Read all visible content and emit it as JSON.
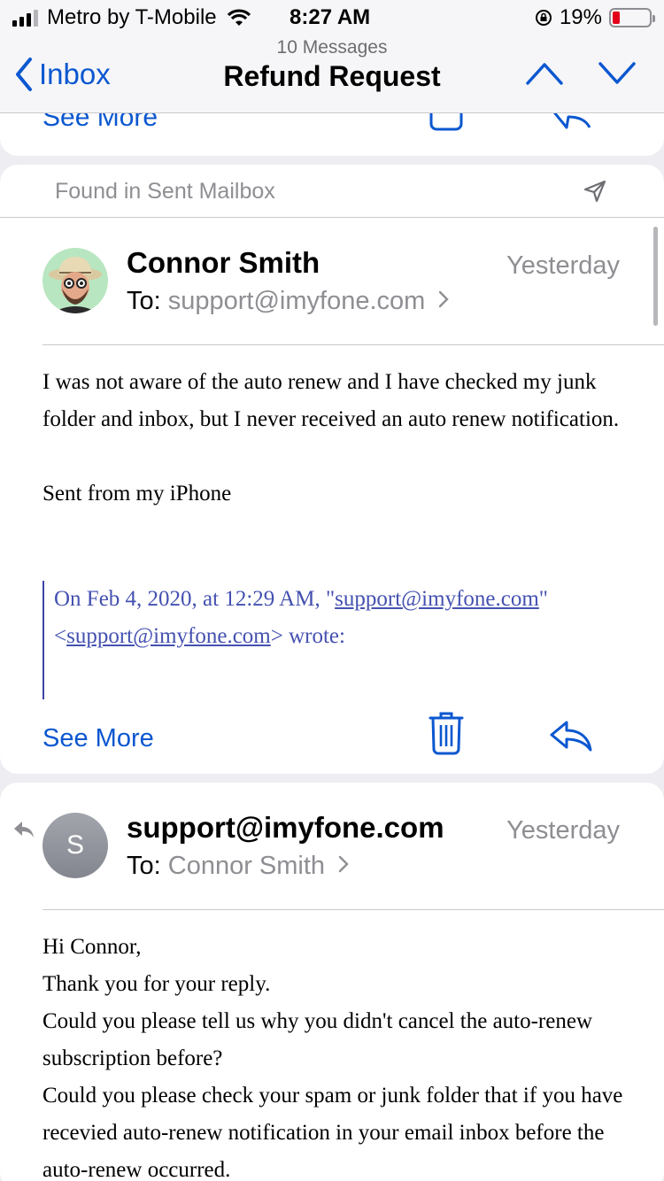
{
  "status_bar": {
    "carrier": "Metro by T-Mobile",
    "time": "8:27 AM",
    "battery_percent": "19%",
    "battery_level": 0.19
  },
  "nav": {
    "back_label": "Inbox",
    "message_count": "10 Messages",
    "title": "Refund Request"
  },
  "prev_card": {
    "see_more": "See More"
  },
  "card2": {
    "found_label": "Found in Sent Mailbox",
    "sender": "Connor Smith",
    "date": "Yesterday",
    "to_label": "To:",
    "to_address": "support@imyfone.com",
    "body": [
      "I was not aware of the auto renew and I have checked my junk folder and inbox, but I never received an auto renew notification.",
      "Sent from my iPhone"
    ],
    "quote_prefix": "On Feb 4, 2020, at 12:29 AM, \"",
    "quote_link1": "support@imyfone.com",
    "quote_mid": "\" <",
    "quote_link2": "support@imyfone.com",
    "quote_suffix": "> wrote:",
    "see_more": "See More"
  },
  "card3": {
    "avatar_letter": "S",
    "sender": "support@imyfone.com",
    "date": "Yesterday",
    "to_label": "To:",
    "to_address": "Connor Smith",
    "body": [
      "Hi Connor,",
      "Thank you for your reply.",
      "Could you please tell us why you didn't cancel the auto-renew subscription before?",
      "Could you please check your spam or junk folder that if you have recevied  auto-renew notification in your email inbox before the auto-renew occurred."
    ]
  },
  "colors": {
    "accent": "#0b57d0",
    "quote": "#4451b0",
    "secondary_text": "#8e8e93",
    "battery_low": "#e3001b"
  }
}
